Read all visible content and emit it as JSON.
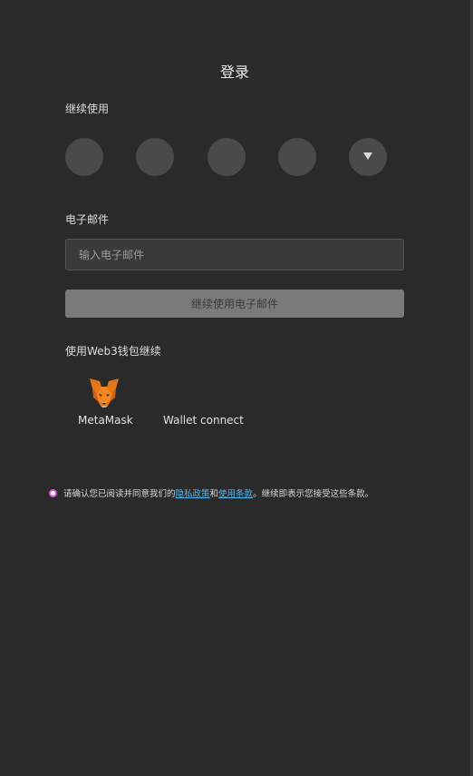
{
  "header": {
    "title": "登录"
  },
  "social": {
    "label": "继续使用",
    "providers": [
      "provider-1",
      "provider-2",
      "provider-3",
      "provider-4"
    ],
    "more_icon": "chevron-down-icon"
  },
  "email": {
    "label": "电子邮件",
    "placeholder": "输入电子邮件",
    "value": "",
    "continue_label": "继续使用电子邮件"
  },
  "web3": {
    "label": "使用Web3钱包继续",
    "wallets": [
      {
        "name": "MetaMask",
        "icon": "metamask-fox-icon"
      },
      {
        "name": "Wallet connect",
        "icon": ""
      }
    ]
  },
  "terms": {
    "prefix": "请确认您已阅读并同意我们的",
    "privacy_link": "隐私政策",
    "and": "和",
    "terms_link": "使用条款",
    "suffix": "。继续即表示您接受这些条款。",
    "checked": true
  },
  "colors": {
    "background": "#2a2a2b",
    "input_bg": "#3a3a3b",
    "button_bg": "#7a7a7a",
    "link": "#53b6f0",
    "radio_accent": "#e255d8",
    "metamask_orange": "#e2761b"
  }
}
